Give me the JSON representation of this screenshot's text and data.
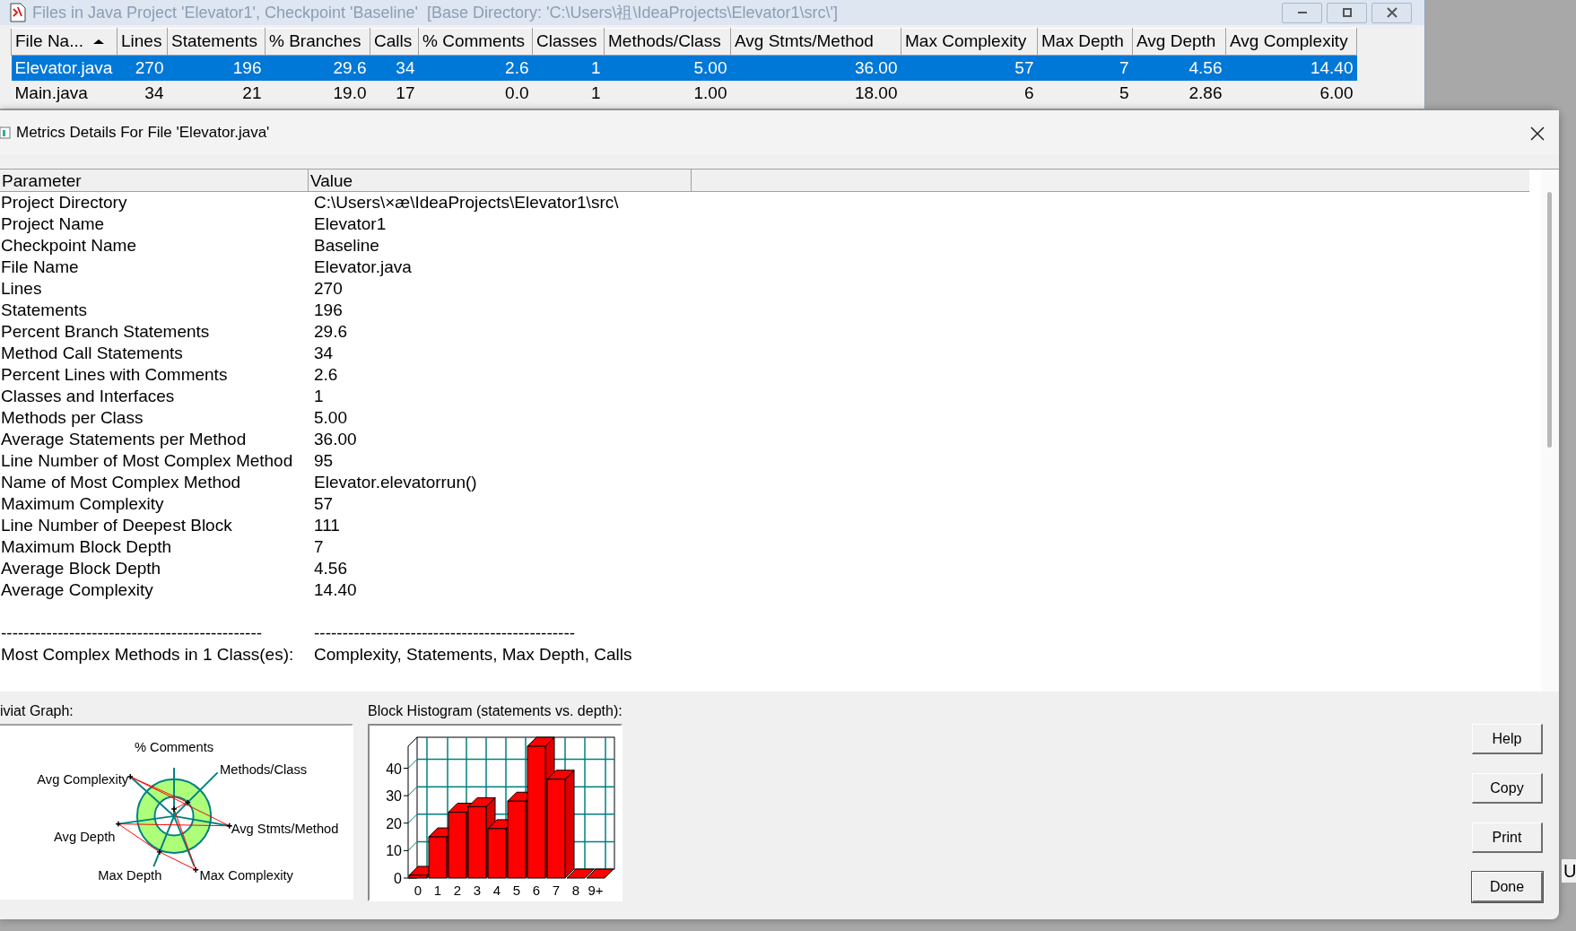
{
  "main_window": {
    "title": "Files in Java Project 'Elevator1', Checkpoint 'Baseline'  [Base Directory: 'C:\\Users\\祖\\IdeaProjects\\Elevator1\\src\\']",
    "table": {
      "columns": [
        {
          "label": "File Na...",
          "sorted": true
        },
        {
          "label": "Lines",
          "sorted": false
        },
        {
          "label": "Statements",
          "sorted": false
        },
        {
          "label": "% Branches",
          "sorted": false
        },
        {
          "label": "Calls",
          "sorted": false
        },
        {
          "label": "% Comments",
          "sorted": false
        },
        {
          "label": "Classes",
          "sorted": false
        },
        {
          "label": "Methods/Class",
          "sorted": false
        },
        {
          "label": "Avg Stmts/Method",
          "sorted": false
        },
        {
          "label": "Max Complexity",
          "sorted": false
        },
        {
          "label": "Max Depth",
          "sorted": false
        },
        {
          "label": "Avg Depth",
          "sorted": false
        },
        {
          "label": "Avg Complexity",
          "sorted": false
        }
      ],
      "rows": [
        {
          "selected": true,
          "cells": [
            "Elevator.java",
            "270",
            "196",
            "29.6",
            "34",
            "2.6",
            "1",
            "5.00",
            "36.00",
            "57",
            "7",
            "4.56",
            "14.40"
          ]
        },
        {
          "selected": false,
          "cells": [
            "Main.java",
            "34",
            "21",
            "19.0",
            "17",
            "0.0",
            "1",
            "1.00",
            "18.00",
            "6",
            "5",
            "2.86",
            "6.00"
          ]
        }
      ]
    }
  },
  "dialog": {
    "title": "Metrics Details For File 'Elevator.java'",
    "table": {
      "columns": [
        "Parameter",
        "Value"
      ],
      "rows": [
        {
          "parameter": "Project Directory",
          "value": "C:\\Users\\×æ\\IdeaProjects\\Elevator1\\src\\"
        },
        {
          "parameter": "Project Name",
          "value": "Elevator1"
        },
        {
          "parameter": "Checkpoint Name",
          "value": "Baseline"
        },
        {
          "parameter": "File Name",
          "value": "Elevator.java"
        },
        {
          "parameter": "Lines",
          "value": "270"
        },
        {
          "parameter": "Statements",
          "value": "196"
        },
        {
          "parameter": "Percent Branch Statements",
          "value": "29.6"
        },
        {
          "parameter": "Method Call Statements",
          "value": "34"
        },
        {
          "parameter": "Percent Lines with Comments",
          "value": "2.6"
        },
        {
          "parameter": "Classes and Interfaces",
          "value": "1"
        },
        {
          "parameter": "Methods per Class",
          "value": "5.00"
        },
        {
          "parameter": "Average Statements per Method",
          "value": "36.00"
        },
        {
          "parameter": "Line Number of Most Complex Method",
          "value": "95"
        },
        {
          "parameter": "Name of Most Complex Method",
          "value": "Elevator.elevatorrun()"
        },
        {
          "parameter": "Maximum Complexity",
          "value": "57"
        },
        {
          "parameter": "Line Number of Deepest Block",
          "value": "111"
        },
        {
          "parameter": "Maximum Block Depth",
          "value": "7"
        },
        {
          "parameter": "Average Block Depth",
          "value": "4.56"
        },
        {
          "parameter": "Average Complexity",
          "value": "14.40"
        }
      ],
      "summary_rows": [
        {
          "parameter": "----------------------------------------------",
          "value": "----------------------------------------------"
        },
        {
          "parameter": "Most Complex Methods in 1 Class(es):",
          "value": "Complexity, Statements, Max Depth, Calls"
        }
      ]
    },
    "kiviat": {
      "label": "iviat Graph:",
      "axes": [
        "% Comments",
        "Methods/Class",
        "Avg Complexity",
        "Avg Stmts/Method",
        "Avg Depth",
        "Max Depth",
        "Max Complexity"
      ]
    },
    "histogram": {
      "label": "Block Histogram (statements vs. depth):",
      "chart_data": {
        "type": "bar",
        "categories": [
          "0",
          "1",
          "2",
          "3",
          "4",
          "5",
          "6",
          "7",
          "8",
          "9+"
        ],
        "values": [
          1,
          15,
          24,
          26,
          18,
          28,
          48,
          36,
          0,
          0
        ],
        "ylim": [
          0,
          48
        ],
        "yticks": [
          0,
          10,
          20,
          30,
          40
        ]
      }
    },
    "buttons": [
      "Help",
      "Copy",
      "Print",
      "Done"
    ]
  },
  "background_text": "U"
}
